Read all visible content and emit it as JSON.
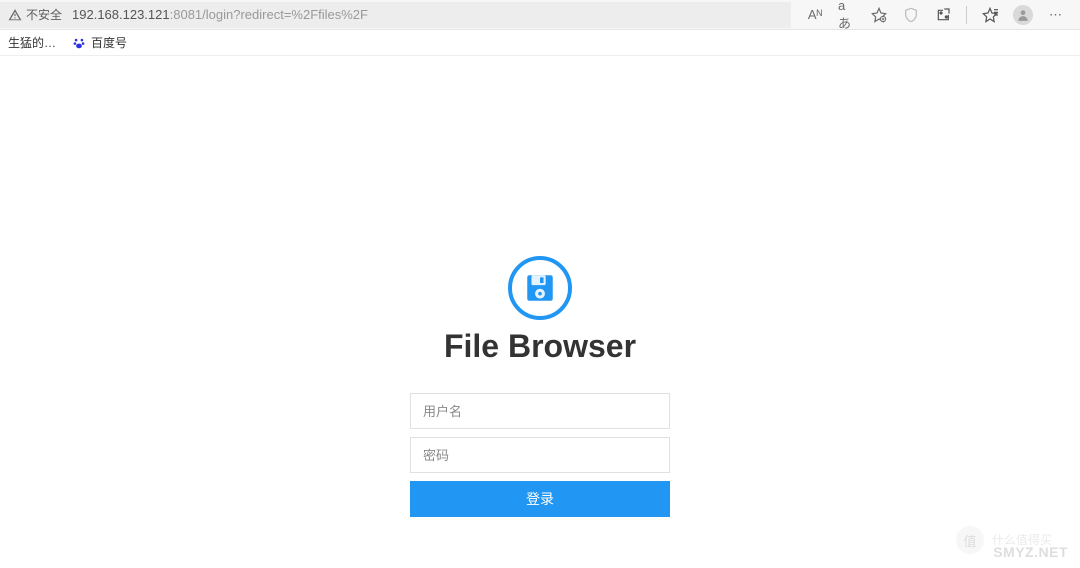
{
  "browser": {
    "security_label": "不安全",
    "url_host": "192.168.123.121",
    "url_rest": ":8081/login?redirect=%2Ffiles%2F",
    "icons": {
      "read_aloud": "Aᴺ",
      "translate": "aあ"
    }
  },
  "bookmarks": {
    "item1": "生猛的…",
    "item2": "百度号"
  },
  "app": {
    "title": "File Browser",
    "username_placeholder": "用户名",
    "password_placeholder": "密码",
    "login_label": "登录"
  },
  "watermark": {
    "text": "SMYZ.NET",
    "circle": "值",
    "sub": "什么值得买"
  },
  "colors": {
    "primary": "#2196f3"
  }
}
